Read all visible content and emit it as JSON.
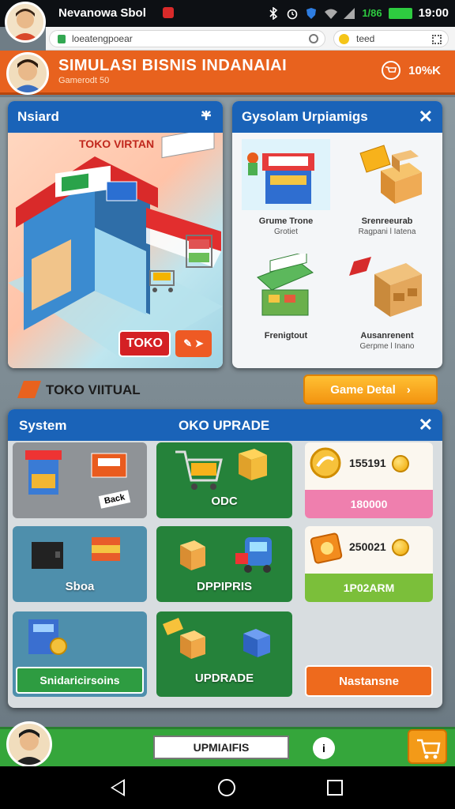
{
  "status_bar": {
    "app_title": "Nevanowa Sbol",
    "signal_text": "1/86",
    "time": "19:00"
  },
  "browser": {
    "url": "loeatengpoear",
    "search_text": "teed"
  },
  "header": {
    "title": "SIMULASI BISNIS INDANAIAI",
    "subtitle": "Gamerodt 50",
    "right_value": "10%K"
  },
  "shop_panel": {
    "title": "Nsiard",
    "scene_label": "TOKO VIRTAN",
    "toko_button": "TOKO"
  },
  "upgrades_panel": {
    "title": "Gysolam Urpiamigs",
    "items": [
      {
        "name": "Grume Trone",
        "desc": "Grotiet"
      },
      {
        "name": "Srenreeurab",
        "desc": "Ragpani l Iatena"
      },
      {
        "name": "Frenigtout",
        "desc": ""
      },
      {
        "name": "Ausanrenent",
        "desc": "Gerpme l Inano"
      }
    ]
  },
  "info_row": {
    "label": "TOKO VIITUAL",
    "detail_button": "Game Detal"
  },
  "upgrade_panel": {
    "title_left": "System",
    "title_center": "OKO UPRADE",
    "tiles": {
      "t1_badge": "Back",
      "t2_label": "ODC",
      "t3_label": "Sboa",
      "t4_label": "DPPIPRIS",
      "t5_label": "Snidaricirsoins",
      "t6_label": "UPDRADE"
    },
    "price1": {
      "value": "155191",
      "bar": "180000"
    },
    "price2": {
      "value": "250021",
      "bar": "1P02ARM"
    },
    "action_button": "Nastansne"
  },
  "bottom_bar": {
    "input_text": "UPMIAIFIS",
    "circle_text": "i"
  },
  "colors": {
    "header_orange": "#e8621e",
    "panel_blue": "#1a63b8",
    "tile_green": "#25823a",
    "tile_gray": "#8f9397",
    "tile_teal": "#4e8fac"
  }
}
